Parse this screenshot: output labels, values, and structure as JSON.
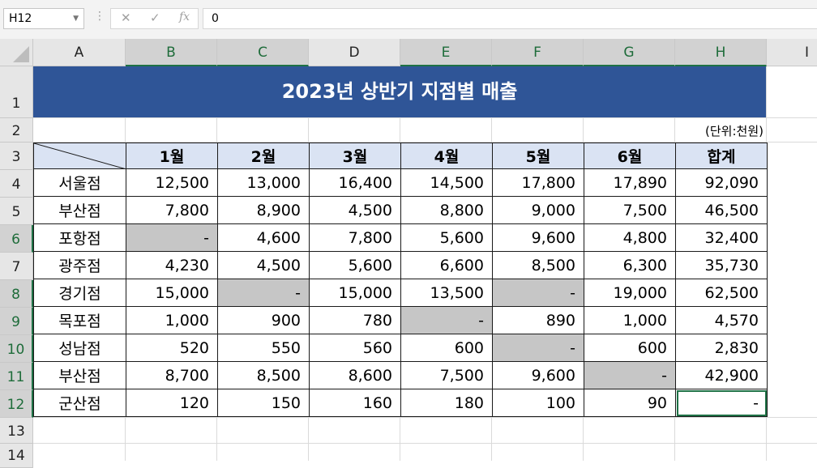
{
  "formula_bar": {
    "name_box": "H12",
    "cancel_icon": "✕",
    "enter_icon": "✓",
    "fx_label": "fx",
    "content": "0"
  },
  "columns": [
    "A",
    "B",
    "C",
    "D",
    "E",
    "F",
    "G",
    "H",
    "I"
  ],
  "rows": [
    "1",
    "2",
    "3",
    "4",
    "5",
    "6",
    "7",
    "8",
    "9",
    "10",
    "11",
    "12",
    "13",
    "14"
  ],
  "sheet": {
    "title": "2023년 상반기 지점별 매출",
    "unit": "(단위:천원)",
    "header": [
      "1월",
      "2월",
      "3월",
      "4월",
      "5월",
      "6월",
      "합계"
    ],
    "data": [
      {
        "name": "서울점",
        "values": [
          "12,500",
          "13,000",
          "16,400",
          "14,500",
          "17,800",
          "17,890",
          "92,090"
        ]
      },
      {
        "name": "부산점",
        "values": [
          "7,800",
          "8,900",
          "4,500",
          "8,800",
          "9,000",
          "7,500",
          "46,500"
        ]
      },
      {
        "name": "포항점",
        "values": [
          "-",
          "4,600",
          "7,800",
          "5,600",
          "9,600",
          "4,800",
          "32,400"
        ]
      },
      {
        "name": "광주점",
        "values": [
          "4,230",
          "4,500",
          "5,600",
          "6,600",
          "8,500",
          "6,300",
          "35,730"
        ]
      },
      {
        "name": "경기점",
        "values": [
          "15,000",
          "-",
          "15,000",
          "13,500",
          "-",
          "19,000",
          "62,500"
        ]
      },
      {
        "name": "목포점",
        "values": [
          "1,000",
          "900",
          "780",
          "-",
          "890",
          "1,000",
          "4,570"
        ]
      },
      {
        "name": "성남점",
        "values": [
          "520",
          "550",
          "560",
          "600",
          "-",
          "600",
          "2,830"
        ]
      },
      {
        "name": "부산점",
        "values": [
          "8,700",
          "8,500",
          "8,600",
          "7,500",
          "9,600",
          "-",
          "42,900"
        ]
      },
      {
        "name": "군산점",
        "values": [
          "120",
          "150",
          "160",
          "180",
          "100",
          "90",
          "-"
        ]
      }
    ]
  },
  "colors": {
    "title_bg": "#2f5597",
    "header_bg": "#dae3f3",
    "blank_cell": "#c6c6c6",
    "selection": "#1e7145"
  }
}
